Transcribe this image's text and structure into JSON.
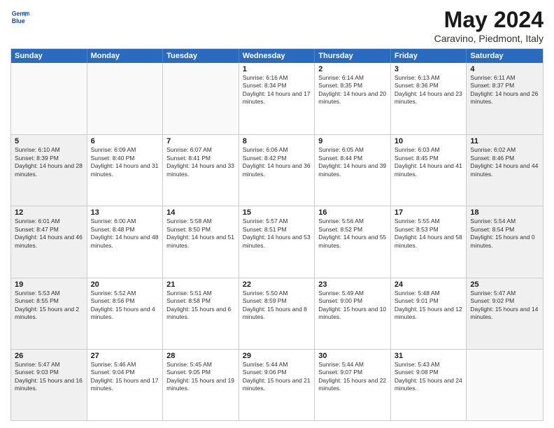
{
  "header": {
    "logo_line1": "General",
    "logo_line2": "Blue",
    "month": "May 2024",
    "location": "Caravino, Piedmont, Italy"
  },
  "days_of_week": [
    "Sunday",
    "Monday",
    "Tuesday",
    "Wednesday",
    "Thursday",
    "Friday",
    "Saturday"
  ],
  "rows": [
    [
      {
        "day": "",
        "empty": true
      },
      {
        "day": "",
        "empty": true
      },
      {
        "day": "",
        "empty": true
      },
      {
        "day": "1",
        "sunrise": "6:16 AM",
        "sunset": "8:34 PM",
        "daylight": "14 hours and 17 minutes."
      },
      {
        "day": "2",
        "sunrise": "6:14 AM",
        "sunset": "8:35 PM",
        "daylight": "14 hours and 20 minutes."
      },
      {
        "day": "3",
        "sunrise": "6:13 AM",
        "sunset": "8:36 PM",
        "daylight": "14 hours and 23 minutes."
      },
      {
        "day": "4",
        "sunrise": "6:11 AM",
        "sunset": "8:37 PM",
        "daylight": "14 hours and 26 minutes.",
        "shaded": true
      }
    ],
    [
      {
        "day": "5",
        "sunrise": "6:10 AM",
        "sunset": "8:39 PM",
        "daylight": "14 hours and 28 minutes.",
        "shaded": true
      },
      {
        "day": "6",
        "sunrise": "6:09 AM",
        "sunset": "8:40 PM",
        "daylight": "14 hours and 31 minutes."
      },
      {
        "day": "7",
        "sunrise": "6:07 AM",
        "sunset": "8:41 PM",
        "daylight": "14 hours and 33 minutes."
      },
      {
        "day": "8",
        "sunrise": "6:06 AM",
        "sunset": "8:42 PM",
        "daylight": "14 hours and 36 minutes."
      },
      {
        "day": "9",
        "sunrise": "6:05 AM",
        "sunset": "8:44 PM",
        "daylight": "14 hours and 39 minutes."
      },
      {
        "day": "10",
        "sunrise": "6:03 AM",
        "sunset": "8:45 PM",
        "daylight": "14 hours and 41 minutes."
      },
      {
        "day": "11",
        "sunrise": "6:02 AM",
        "sunset": "8:46 PM",
        "daylight": "14 hours and 44 minutes.",
        "shaded": true
      }
    ],
    [
      {
        "day": "12",
        "sunrise": "6:01 AM",
        "sunset": "8:47 PM",
        "daylight": "14 hours and 46 minutes.",
        "shaded": true
      },
      {
        "day": "13",
        "sunrise": "6:00 AM",
        "sunset": "8:48 PM",
        "daylight": "14 hours and 48 minutes."
      },
      {
        "day": "14",
        "sunrise": "5:58 AM",
        "sunset": "8:50 PM",
        "daylight": "14 hours and 51 minutes."
      },
      {
        "day": "15",
        "sunrise": "5:57 AM",
        "sunset": "8:51 PM",
        "daylight": "14 hours and 53 minutes."
      },
      {
        "day": "16",
        "sunrise": "5:56 AM",
        "sunset": "8:52 PM",
        "daylight": "14 hours and 55 minutes."
      },
      {
        "day": "17",
        "sunrise": "5:55 AM",
        "sunset": "8:53 PM",
        "daylight": "14 hours and 58 minutes."
      },
      {
        "day": "18",
        "sunrise": "5:54 AM",
        "sunset": "8:54 PM",
        "daylight": "15 hours and 0 minutes.",
        "shaded": true
      }
    ],
    [
      {
        "day": "19",
        "sunrise": "5:53 AM",
        "sunset": "8:55 PM",
        "daylight": "15 hours and 2 minutes.",
        "shaded": true
      },
      {
        "day": "20",
        "sunrise": "5:52 AM",
        "sunset": "8:56 PM",
        "daylight": "15 hours and 4 minutes."
      },
      {
        "day": "21",
        "sunrise": "5:51 AM",
        "sunset": "8:58 PM",
        "daylight": "15 hours and 6 minutes."
      },
      {
        "day": "22",
        "sunrise": "5:50 AM",
        "sunset": "8:59 PM",
        "daylight": "15 hours and 8 minutes."
      },
      {
        "day": "23",
        "sunrise": "5:49 AM",
        "sunset": "9:00 PM",
        "daylight": "15 hours and 10 minutes."
      },
      {
        "day": "24",
        "sunrise": "5:48 AM",
        "sunset": "9:01 PM",
        "daylight": "15 hours and 12 minutes."
      },
      {
        "day": "25",
        "sunrise": "5:47 AM",
        "sunset": "9:02 PM",
        "daylight": "15 hours and 14 minutes.",
        "shaded": true
      }
    ],
    [
      {
        "day": "26",
        "sunrise": "5:47 AM",
        "sunset": "9:03 PM",
        "daylight": "15 hours and 16 minutes.",
        "shaded": true
      },
      {
        "day": "27",
        "sunrise": "5:46 AM",
        "sunset": "9:04 PM",
        "daylight": "15 hours and 17 minutes."
      },
      {
        "day": "28",
        "sunrise": "5:45 AM",
        "sunset": "9:05 PM",
        "daylight": "15 hours and 19 minutes."
      },
      {
        "day": "29",
        "sunrise": "5:44 AM",
        "sunset": "9:06 PM",
        "daylight": "15 hours and 21 minutes."
      },
      {
        "day": "30",
        "sunrise": "5:44 AM",
        "sunset": "9:07 PM",
        "daylight": "15 hours and 22 minutes."
      },
      {
        "day": "31",
        "sunrise": "5:43 AM",
        "sunset": "9:08 PM",
        "daylight": "15 hours and 24 minutes."
      },
      {
        "day": "",
        "empty": true,
        "shaded": true
      }
    ]
  ],
  "labels": {
    "sunrise_prefix": "Sunrise: ",
    "sunset_prefix": "Sunset: ",
    "daylight_prefix": "Daylight: "
  }
}
